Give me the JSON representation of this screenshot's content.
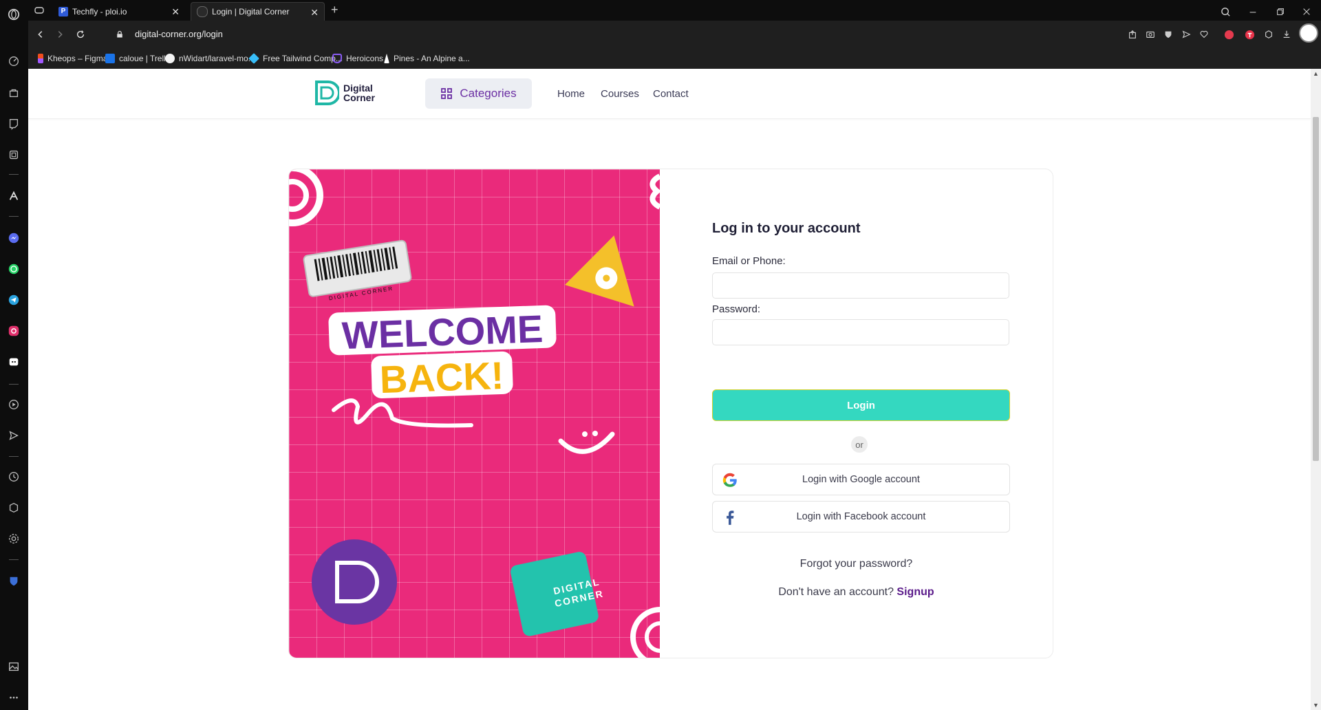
{
  "browser": {
    "tabs": [
      {
        "title": "Techfly - ploi.io",
        "favicon": "P",
        "active": false
      },
      {
        "title": "Login | Digital Corner",
        "favicon": "",
        "active": true
      }
    ],
    "url": "digital-corner.org/login",
    "bookmarks": [
      {
        "label": "Kheops – Figma",
        "icon": "figma-icon"
      },
      {
        "label": "caloue | Trello",
        "icon": "trello-icon"
      },
      {
        "label": "nWidart/laravel-mo...",
        "icon": "github-icon"
      },
      {
        "label": "Free Tailwind Comp...",
        "icon": "tailwind-icon"
      },
      {
        "label": "Heroicons",
        "icon": "heroicons-icon"
      },
      {
        "label": "Pines - An Alpine a...",
        "icon": "pines-icon"
      }
    ]
  },
  "site": {
    "logo_line1": "Digital",
    "logo_line2": "Corner",
    "categories_label": "Categories",
    "nav": [
      "Home",
      "Courses",
      "Contact"
    ],
    "brand_color": "#6b2fa3",
    "accent_color": "#34d8c0"
  },
  "hero": {
    "line1": "WELCOME",
    "line2": "BACK!",
    "sticker_text": "DIGITAL CORNER",
    "barcode_text": "DIGITAL CORNER",
    "background": "#ea2a7b"
  },
  "form": {
    "title": "Log in to your account",
    "email_label": "Email or Phone:",
    "email_value": "",
    "password_label": "Password:",
    "password_value": "",
    "login_label": "Login",
    "or_label": "or",
    "google_label": "Login with Google account",
    "facebook_label": "Login with Facebook account",
    "forgot_label": "Forgot your password?",
    "no_account_label": "Don't have an account?",
    "signup_label": "Signup"
  }
}
